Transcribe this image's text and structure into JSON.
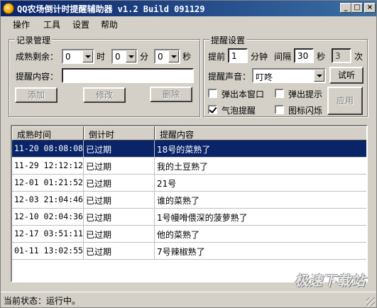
{
  "window": {
    "title": "QQ农场倒计时提醒辅助器 v1.2 Build 091129",
    "minimize_label": "_",
    "maximize_label": "□",
    "close_label": "×"
  },
  "menu": {
    "items": [
      "操作",
      "工具",
      "设置",
      "帮助"
    ]
  },
  "record_group": {
    "title": "记录管理",
    "remaining_label": "成熟剩余：",
    "hours_value": "0",
    "hours_unit": "时",
    "minutes_value": "0",
    "minutes_unit": "分",
    "seconds_value": "0",
    "seconds_unit": "秒",
    "content_label": "提醒内容：",
    "content_value": "",
    "add_label": "添加",
    "edit_label": "修改",
    "delete_label": "删除"
  },
  "reminder_group": {
    "title": "提醒设置",
    "advance_label": "提前",
    "advance_value": "1",
    "advance_unit": "分钟",
    "interval_label": "间隔",
    "interval_value": "30",
    "interval_unit": "秒",
    "count_value": "3",
    "count_unit": "次",
    "sound_label": "提醒声音：",
    "sound_value": "叮咚",
    "listen_label": "试听",
    "apply_label": "应用",
    "options": [
      {
        "label": "弹出本窗口",
        "checked": false
      },
      {
        "label": "弹出提示",
        "checked": false
      },
      {
        "label": "气泡提醒",
        "checked": true
      },
      {
        "label": "图标闪烁",
        "checked": false
      }
    ]
  },
  "table": {
    "columns": [
      "成熟时间",
      "倒计时",
      "提醒内容"
    ],
    "rows": [
      {
        "time": "11-20 08:08:08",
        "countdown": "已过期",
        "content": "18号的菜熟了"
      },
      {
        "time": "11-29 12:12:12",
        "countdown": "已过期",
        "content": "我的土豆熟了"
      },
      {
        "time": "12-01 01:21:52",
        "countdown": "已过期",
        "content": "21号"
      },
      {
        "time": "12-03 21:04:46",
        "countdown": "已过期",
        "content": "谁的菜熟了"
      },
      {
        "time": "12-10 02:04:36",
        "countdown": "已过期",
        "content": "1号幔嗗偎深的菠萝熟了"
      },
      {
        "time": "12-17 03:51:11",
        "countdown": "已过期",
        "content": "他的菜熟了"
      },
      {
        "time": "01-11 13:02:55",
        "countdown": "已过期",
        "content": "7号辣椒熟了"
      }
    ],
    "selected_index": 0
  },
  "status": {
    "text": "当前状态：运行中。"
  },
  "watermark": "极速下载站",
  "colors": {
    "titlebar": "#0a246a",
    "selection": "#0a246a",
    "face": "#d4d0c8"
  }
}
